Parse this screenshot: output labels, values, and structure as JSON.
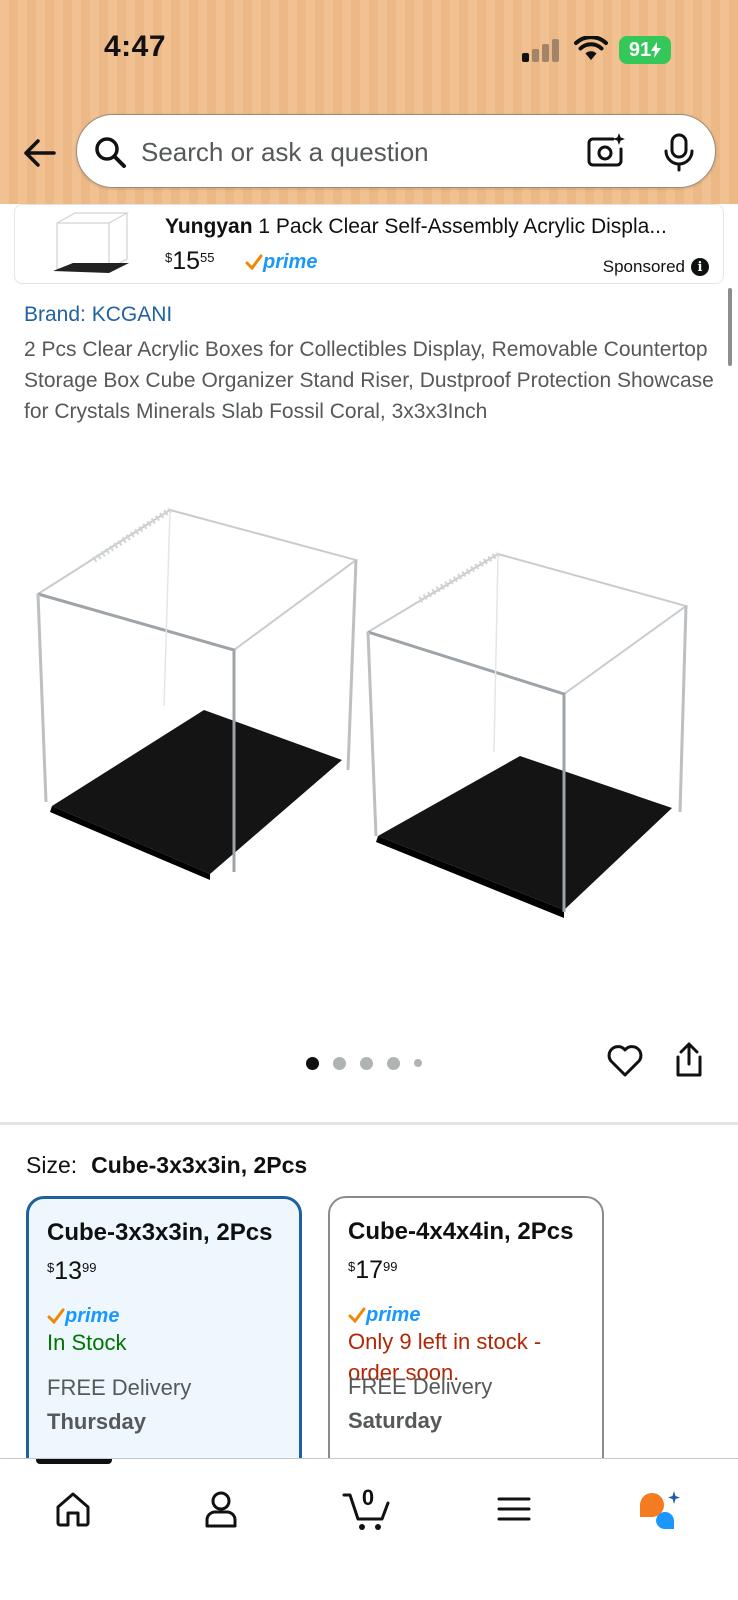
{
  "status_bar": {
    "time": "4:47",
    "battery": "91"
  },
  "search": {
    "placeholder": "Search or ask a question"
  },
  "sponsored": {
    "brand": "Yungyan",
    "title": "1 Pack Clear Self-Assembly Acrylic Displa...",
    "price_currency": "$",
    "price_whole": "15",
    "price_fraction": "55",
    "prime_label": "prime",
    "label": "Sponsored",
    "info_icon": "info-icon"
  },
  "product": {
    "brand_link": "Brand: KCGANI",
    "title": "2 Pcs Clear Acrylic Boxes for Collectibles Display, Removable Countertop Storage Box Cube Organizer Stand Riser, Dustproof Protection Showcase for Crystals Minerals Slab Fossil Coral, 3x3x3Inch",
    "image_count": 5,
    "active_image": 1
  },
  "size": {
    "label": "Size:",
    "selected": "Cube-3x3x3in, 2Pcs",
    "options": [
      {
        "name": "Cube-3x3x3in, 2Pcs",
        "currency": "$",
        "price_whole": "13",
        "price_fraction": "99",
        "prime": "prime",
        "stock": "In Stock",
        "delivery": "FREE Delivery",
        "day": "Thursday"
      },
      {
        "name": "Cube-4x4x4in, 2Pcs",
        "currency": "$",
        "price_whole": "17",
        "price_fraction": "99",
        "prime": "prime",
        "stock": "Only 9 left in stock - order soon.",
        "delivery": "FREE Delivery",
        "day": "Saturday"
      }
    ]
  },
  "bottom_nav": {
    "cart_count": "0",
    "active": "home"
  },
  "colors": {
    "header_bg": "#f2c191",
    "link": "#2162a1",
    "in_stock": "#007600",
    "low_stock": "#b12704",
    "selected_border": "#1f5f9e",
    "prime_blue": "#1a98ff",
    "prime_check": "#f08804"
  }
}
